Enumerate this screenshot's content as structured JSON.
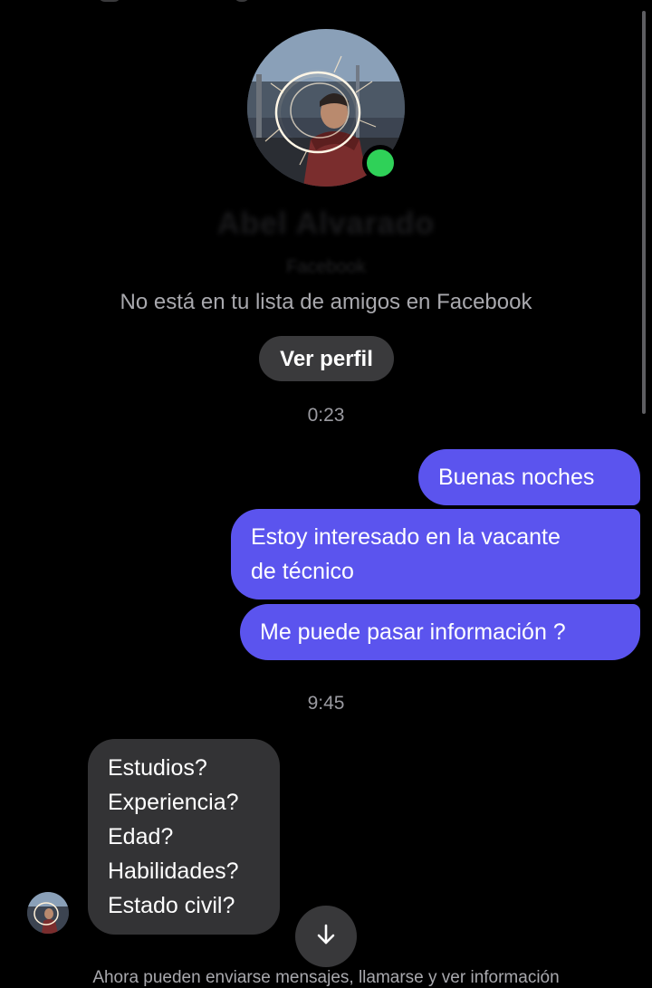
{
  "profile": {
    "name": "Abel Alvarado",
    "platform": "Facebook",
    "friend_status": "No está en tu lista de amigos en Facebook",
    "view_profile_label": "Ver perfil",
    "online_status_color": "#2fd158"
  },
  "conversation": {
    "timestamp_1": "0:23",
    "outgoing": [
      {
        "lines": [
          "Buenas noches"
        ]
      },
      {
        "lines": [
          "Estoy interesado en la vacante",
          "de técnico"
        ]
      },
      {
        "lines": [
          "Me puede pasar información ?"
        ]
      }
    ],
    "timestamp_2": "9:45",
    "incoming": [
      {
        "lines": [
          "Estudios?",
          "Experiencia?",
          "Edad?",
          "Habilidades?",
          "Estado civil?"
        ]
      }
    ]
  },
  "footer": {
    "note": "Ahora pueden enviarse mensajes, llamarse y ver información"
  },
  "colors": {
    "background": "#000000",
    "outgoing_bubble": "#5b54ee",
    "incoming_bubble": "#333335",
    "button_bg": "#3a3a3c",
    "secondary_text": "#a8a8ad"
  },
  "icons": {
    "scroll_down": "arrow-down-icon"
  }
}
